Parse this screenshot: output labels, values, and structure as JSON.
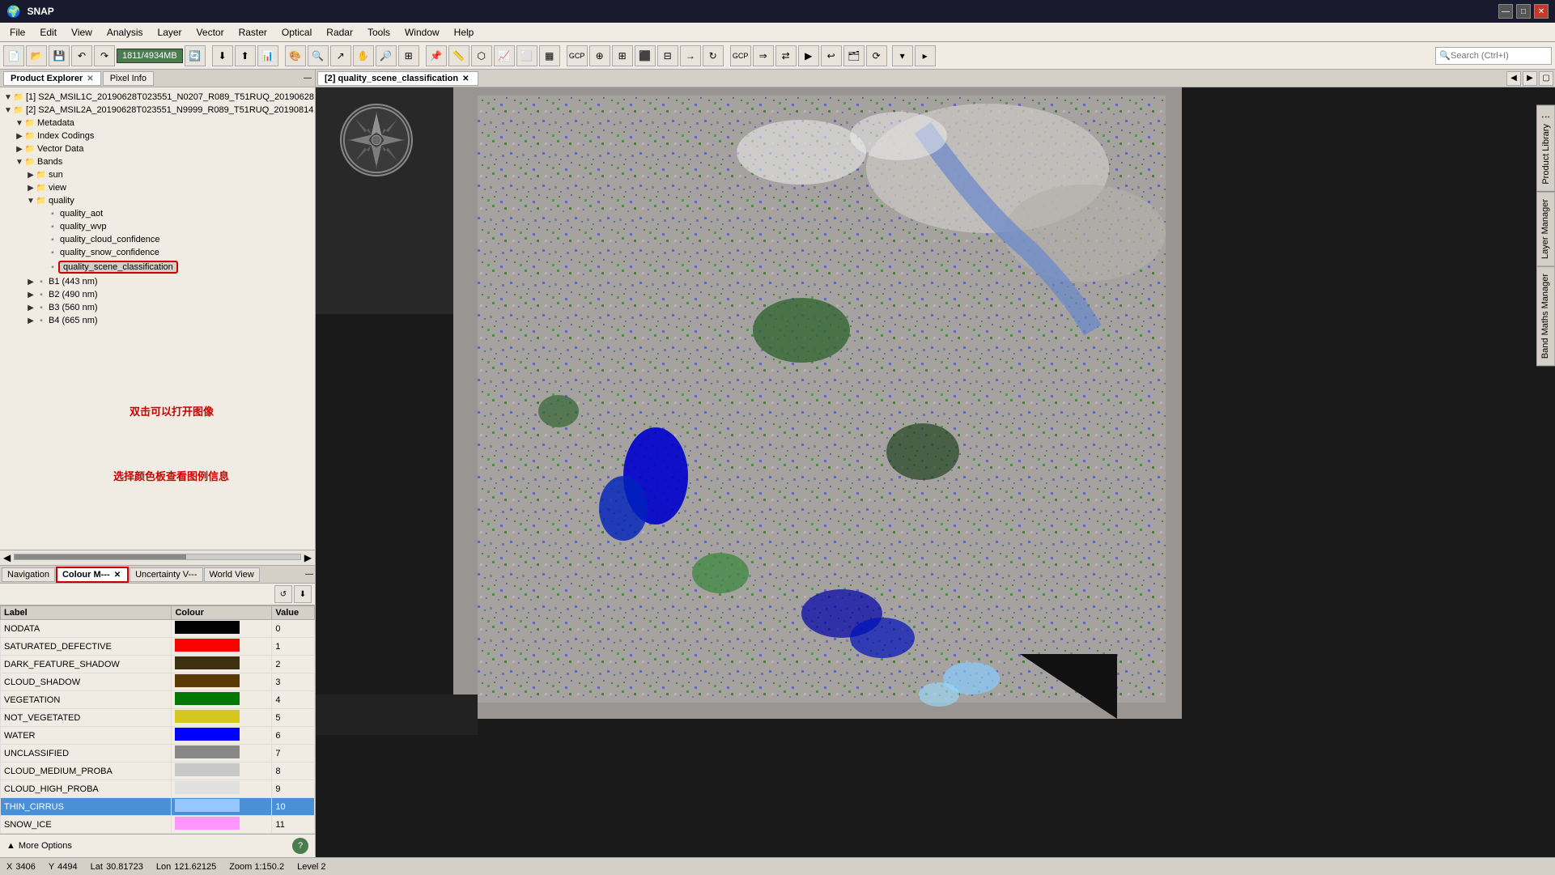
{
  "titlebar": {
    "title": "SNAP",
    "controls": [
      "—",
      "□",
      "✕"
    ]
  },
  "menubar": {
    "items": [
      "File",
      "Edit",
      "View",
      "Analysis",
      "Layer",
      "Vector",
      "Raster",
      "Optical",
      "Radar",
      "Tools",
      "Window",
      "Help"
    ]
  },
  "toolbar": {
    "progress_label": "1811/4934MB",
    "search_placeholder": "Search (Ctrl+I)"
  },
  "product_explorer": {
    "tabs": [
      {
        "label": "Product Explorer",
        "active": true
      },
      {
        "label": "Pixel Info",
        "active": false
      }
    ],
    "tree": [
      {
        "id": "s2a1",
        "level": 0,
        "toggle": "▼",
        "icon": "📁",
        "label": "[1] S2A_MSIL1C_20190628T023551_N0207_R089_T51RUQ_20190628…"
      },
      {
        "id": "s2a2",
        "level": 0,
        "toggle": "▼",
        "icon": "📁",
        "label": "[2] S2A_MSIL2A_20190628T023551_N9999_R089_T51RUQ_20190814…"
      },
      {
        "id": "metadata",
        "level": 1,
        "toggle": "▼",
        "icon": "📁",
        "label": "Metadata"
      },
      {
        "id": "indexcodings",
        "level": 1,
        "toggle": "▶",
        "icon": "📁",
        "label": "Index Codings"
      },
      {
        "id": "vectordata",
        "level": 1,
        "toggle": "▶",
        "icon": "📁",
        "label": "Vector Data"
      },
      {
        "id": "bands",
        "level": 1,
        "toggle": "▼",
        "icon": "📁",
        "label": "Bands"
      },
      {
        "id": "sun",
        "level": 2,
        "toggle": "▶",
        "icon": "📁",
        "label": "sun"
      },
      {
        "id": "view",
        "level": 2,
        "toggle": "▶",
        "icon": "📁",
        "label": "view"
      },
      {
        "id": "quality",
        "level": 2,
        "toggle": "▼",
        "icon": "📁",
        "label": "quality"
      },
      {
        "id": "quality_aot",
        "level": 3,
        "toggle": "",
        "icon": "▪",
        "label": "quality_aot"
      },
      {
        "id": "quality_wvp",
        "level": 3,
        "toggle": "",
        "icon": "▪",
        "label": "quality_wvp"
      },
      {
        "id": "quality_cloud_confidence",
        "level": 3,
        "toggle": "",
        "icon": "▪",
        "label": "quality_cloud_confidence"
      },
      {
        "id": "quality_snow_confidence",
        "level": 3,
        "toggle": "",
        "icon": "▪",
        "label": "quality_snow_confidence"
      },
      {
        "id": "quality_scene_classification",
        "level": 3,
        "toggle": "",
        "icon": "▪",
        "label": "quality_scene_classification",
        "highlighted": true
      },
      {
        "id": "b1",
        "level": 2,
        "toggle": "▶",
        "icon": "▪",
        "label": "B1 (443 nm)"
      },
      {
        "id": "b2",
        "level": 2,
        "toggle": "▶",
        "icon": "▪",
        "label": "B2 (490 nm)"
      },
      {
        "id": "b3",
        "level": 2,
        "toggle": "▶",
        "icon": "▪",
        "label": "B3 (560 nm)"
      },
      {
        "id": "b4",
        "level": 2,
        "toggle": "▶",
        "icon": "▪",
        "label": "B4 (665 nm)"
      }
    ],
    "annotation1": "双击可以打开图像",
    "annotation2": "选择颜色板查看图例信息"
  },
  "nav_panel": {
    "tabs": [
      {
        "label": "Navigation",
        "active": false
      },
      {
        "label": "Colour M---",
        "active": true
      },
      {
        "label": "Uncertainty V---",
        "active": false
      },
      {
        "label": "World View",
        "active": false
      }
    ]
  },
  "colour_manager": {
    "columns": [
      "Label",
      "Colour",
      "Value"
    ],
    "rows": [
      {
        "label": "NODATA",
        "colour": "#000000",
        "value": "0",
        "selected": false
      },
      {
        "label": "SATURATED_DEFECTIVE",
        "colour": "#ff0000",
        "value": "1",
        "selected": false
      },
      {
        "label": "DARK_FEATURE_SHADOW",
        "colour": "#3c3010",
        "value": "2",
        "selected": false
      },
      {
        "label": "CLOUD_SHADOW",
        "colour": "#5a3a00",
        "value": "3",
        "selected": false
      },
      {
        "label": "VEGETATION",
        "colour": "#007700",
        "value": "4",
        "selected": false
      },
      {
        "label": "NOT_VEGETATED",
        "colour": "#d4c820",
        "value": "5",
        "selected": false
      },
      {
        "label": "WATER",
        "colour": "#0000ff",
        "value": "6",
        "selected": false
      },
      {
        "label": "UNCLASSIFIED",
        "colour": "#888888",
        "value": "7",
        "selected": false
      },
      {
        "label": "CLOUD_MEDIUM_PROBA",
        "colour": "#c8c8c8",
        "value": "8",
        "selected": false
      },
      {
        "label": "CLOUD_HIGH_PROBA",
        "colour": "#e0e0e0",
        "value": "9",
        "selected": false
      },
      {
        "label": "THIN_CIRRUS",
        "colour": "#96c8ff",
        "value": "10",
        "selected": true
      },
      {
        "label": "SNOW_ICE",
        "colour": "#ff96ff",
        "value": "11",
        "selected": false
      }
    ],
    "more_options": "More Options",
    "help": "?"
  },
  "view_panel": {
    "tabs": [
      {
        "label": "[2] quality_scene_classification",
        "active": true
      }
    ],
    "image_title": "quality_scene_classification satellite image"
  },
  "side_tabs": [
    "Product Library ⋮",
    "Layer Manager",
    "Band Maths Manager"
  ],
  "status_bar": {
    "x_label": "X",
    "x_value": "3406",
    "y_label": "Y",
    "y_value": "4494",
    "lat_label": "Lat",
    "lat_value": "30.81723",
    "lon_label": "Lon",
    "lon_value": "121.62125",
    "zoom_label": "Zoom 1:150.2",
    "level_label": "Level 2"
  }
}
